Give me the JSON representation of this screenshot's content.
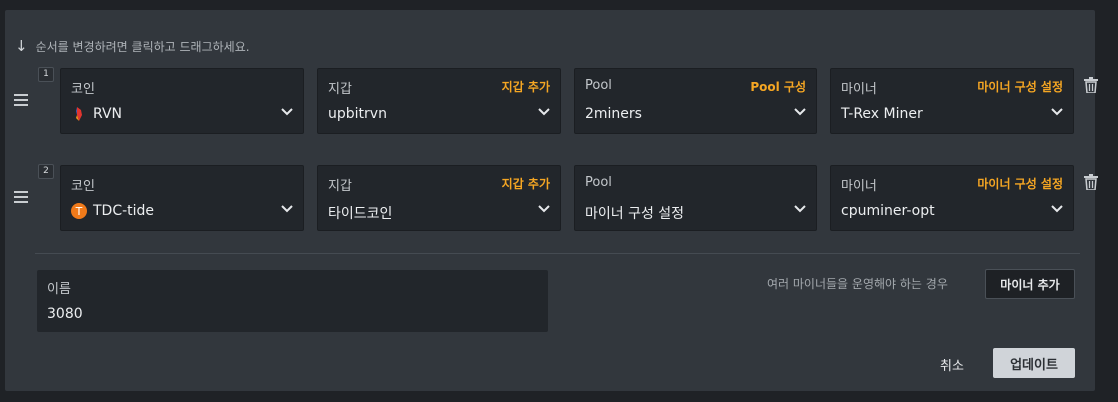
{
  "hint": "순서를 변경하려면 클릭하고 드래그하세요.",
  "rows": [
    {
      "index": "1",
      "coin": {
        "label": "코인",
        "value": "RVN",
        "icon": "rvn-coin-icon"
      },
      "wallet": {
        "label": "지갑",
        "action": "지갑 추가",
        "value": "upbitrvn"
      },
      "pool": {
        "label": "Pool",
        "action": "Pool 구성",
        "value": "2miners"
      },
      "miner": {
        "label": "마이너",
        "action": "마이너 구성 설정",
        "value": "T-Rex Miner"
      }
    },
    {
      "index": "2",
      "coin": {
        "label": "코인",
        "value": "TDC-tide",
        "icon": "tdc-coin-icon"
      },
      "wallet": {
        "label": "지갑",
        "action": "지갑 추가",
        "value": "타이드코인"
      },
      "pool": {
        "label": "Pool",
        "action": "",
        "value": "마이너 구성 설정"
      },
      "miner": {
        "label": "마이너",
        "action": "마이너 구성 설정",
        "value": "cpuminer-opt"
      }
    }
  ],
  "name": {
    "label": "이름",
    "value": "3080"
  },
  "multi_miner_hint": "여러 마이너들을 운영해야 하는 경우",
  "add_miner_label": "마이너 추가",
  "cancel_label": "취소",
  "update_label": "업데이트",
  "colors": {
    "accent": "#f5a623",
    "panel": "#32373d",
    "field": "#22262b"
  }
}
